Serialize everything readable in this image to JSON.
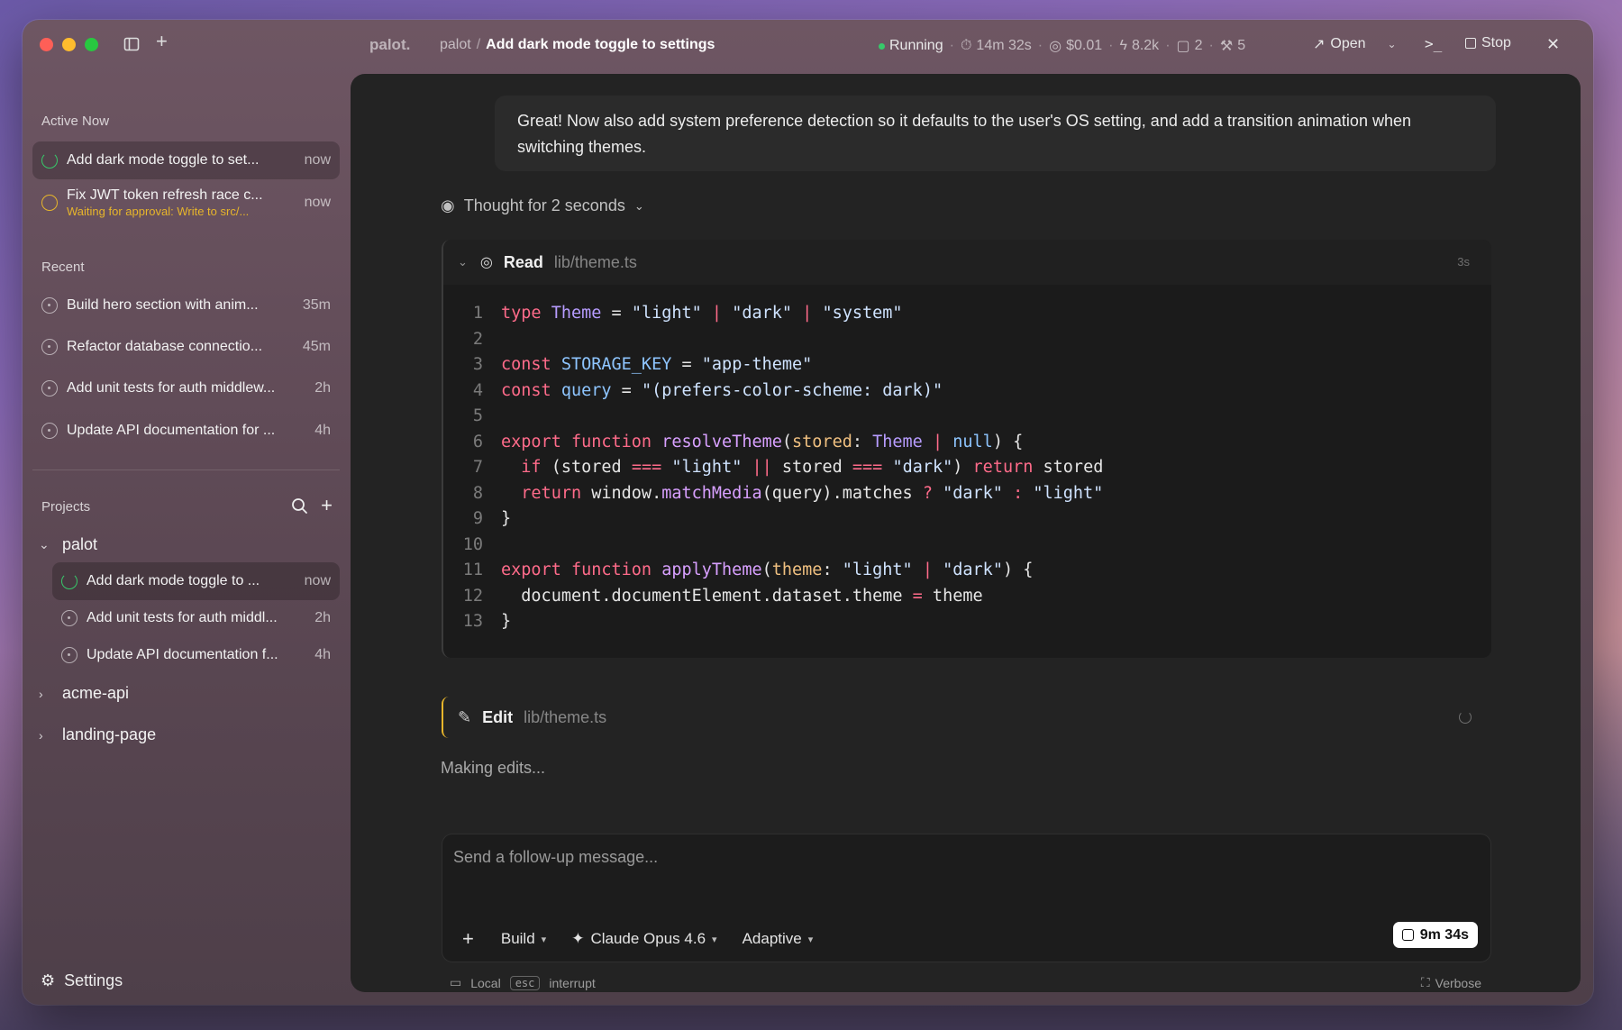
{
  "titlebar": {
    "brand": "palot.",
    "breadcrumb_project": "palot",
    "breadcrumb_sep": "/",
    "breadcrumb_title": "Add dark mode toggle to settings",
    "status": "Running",
    "elapsed": "14m 32s",
    "cost": "$0.01",
    "tokens": "8.2k",
    "messages": "2",
    "tools": "5",
    "open_label": "Open",
    "stop_label": "Stop"
  },
  "sidebar": {
    "active_label": "Active Now",
    "active": [
      {
        "title": "Add dark mode toggle to set...",
        "time": "now",
        "state": "running"
      },
      {
        "title": "Fix JWT token refresh race c...",
        "subtitle": "Waiting for approval: Write to src/...",
        "time": "now",
        "state": "waiting"
      }
    ],
    "recent_label": "Recent",
    "recent": [
      {
        "title": "Build hero section with anim...",
        "time": "35m"
      },
      {
        "title": "Refactor database connectio...",
        "time": "45m"
      },
      {
        "title": "Add unit tests for auth middlew...",
        "time": "2h"
      },
      {
        "title": "Update API documentation for ...",
        "time": "4h"
      }
    ],
    "projects_label": "Projects",
    "projects": [
      {
        "name": "palot",
        "expanded": true,
        "sessions": [
          {
            "title": "Add dark mode toggle to ...",
            "time": "now",
            "state": "running"
          },
          {
            "title": "Add unit tests for auth middl...",
            "time": "2h"
          },
          {
            "title": "Update API documentation f...",
            "time": "4h"
          }
        ]
      },
      {
        "name": "acme-api",
        "expanded": false
      },
      {
        "name": "landing-page",
        "expanded": false
      }
    ],
    "settings_label": "Settings"
  },
  "conversation": {
    "user_message": "Great! Now also add system preference detection so it defaults to the user's OS setting, and add a transition animation when switching themes.",
    "thought": "Thought for 2 seconds",
    "read_tool": {
      "label": "Read",
      "path": "lib/theme.ts",
      "duration": "3s"
    },
    "edit_tool": {
      "label": "Edit",
      "path": "lib/theme.ts"
    },
    "making_edits": "Making edits..."
  },
  "code_lines": [
    [
      [
        "kw",
        "type "
      ],
      [
        "ty",
        "Theme"
      ],
      [
        "src",
        " = "
      ],
      [
        "st",
        "\"light\""
      ],
      [
        "kw",
        " | "
      ],
      [
        "st",
        "\"dark\""
      ],
      [
        "kw",
        " | "
      ],
      [
        "st",
        "\"system\""
      ]
    ],
    [],
    [
      [
        "kw",
        "const "
      ],
      [
        "cs",
        "STORAGE_KEY"
      ],
      [
        "src",
        " = "
      ],
      [
        "st",
        "\"app-theme\""
      ]
    ],
    [
      [
        "kw",
        "const "
      ],
      [
        "cs",
        "query"
      ],
      [
        "src",
        " = "
      ],
      [
        "st",
        "\"(prefers-color-scheme: dark)\""
      ]
    ],
    [],
    [
      [
        "kw",
        "export function "
      ],
      [
        "fn",
        "resolveTheme"
      ],
      [
        "src",
        "("
      ],
      [
        "pr",
        "stored"
      ],
      [
        "src",
        ": "
      ],
      [
        "ty",
        "Theme"
      ],
      [
        "kw",
        " | "
      ],
      [
        "cs",
        "null"
      ],
      [
        "src",
        ") {"
      ]
    ],
    [
      [
        "src",
        "  "
      ],
      [
        "kw",
        "if"
      ],
      [
        "src",
        " (stored "
      ],
      [
        "kw",
        "==="
      ],
      [
        "src",
        " "
      ],
      [
        "st",
        "\"light\""
      ],
      [
        "src",
        " "
      ],
      [
        "kw",
        "||"
      ],
      [
        "src",
        " stored "
      ],
      [
        "kw",
        "==="
      ],
      [
        "src",
        " "
      ],
      [
        "st",
        "\"dark\""
      ],
      [
        "src",
        ") "
      ],
      [
        "kw",
        "return"
      ],
      [
        "src",
        " stored"
      ]
    ],
    [
      [
        "src",
        "  "
      ],
      [
        "kw",
        "return"
      ],
      [
        "src",
        " window."
      ],
      [
        "fn",
        "matchMedia"
      ],
      [
        "src",
        "(query).matches "
      ],
      [
        "kw",
        "?"
      ],
      [
        "src",
        " "
      ],
      [
        "st",
        "\"dark\""
      ],
      [
        "src",
        " "
      ],
      [
        "kw",
        ":"
      ],
      [
        "src",
        " "
      ],
      [
        "st",
        "\"light\""
      ]
    ],
    [
      [
        "src",
        "}"
      ]
    ],
    [],
    [
      [
        "kw",
        "export function "
      ],
      [
        "fn",
        "applyTheme"
      ],
      [
        "src",
        "("
      ],
      [
        "pr",
        "theme"
      ],
      [
        "src",
        ": "
      ],
      [
        "st",
        "\"light\""
      ],
      [
        "kw",
        " | "
      ],
      [
        "st",
        "\"dark\""
      ],
      [
        "src",
        ") {"
      ]
    ],
    [
      [
        "src",
        "  document.documentElement.dataset.theme "
      ],
      [
        "kw",
        "="
      ],
      [
        "src",
        " theme"
      ]
    ],
    [
      [
        "src",
        "}"
      ]
    ]
  ],
  "composer": {
    "placeholder": "Send a follow-up message...",
    "mode": "Build",
    "model": "Claude Opus 4.6",
    "reasoning": "Adaptive",
    "timer": "9m 34s"
  },
  "footer": {
    "location": "Local",
    "key": "esc",
    "key_action": "interrupt",
    "verbose": "Verbose"
  }
}
